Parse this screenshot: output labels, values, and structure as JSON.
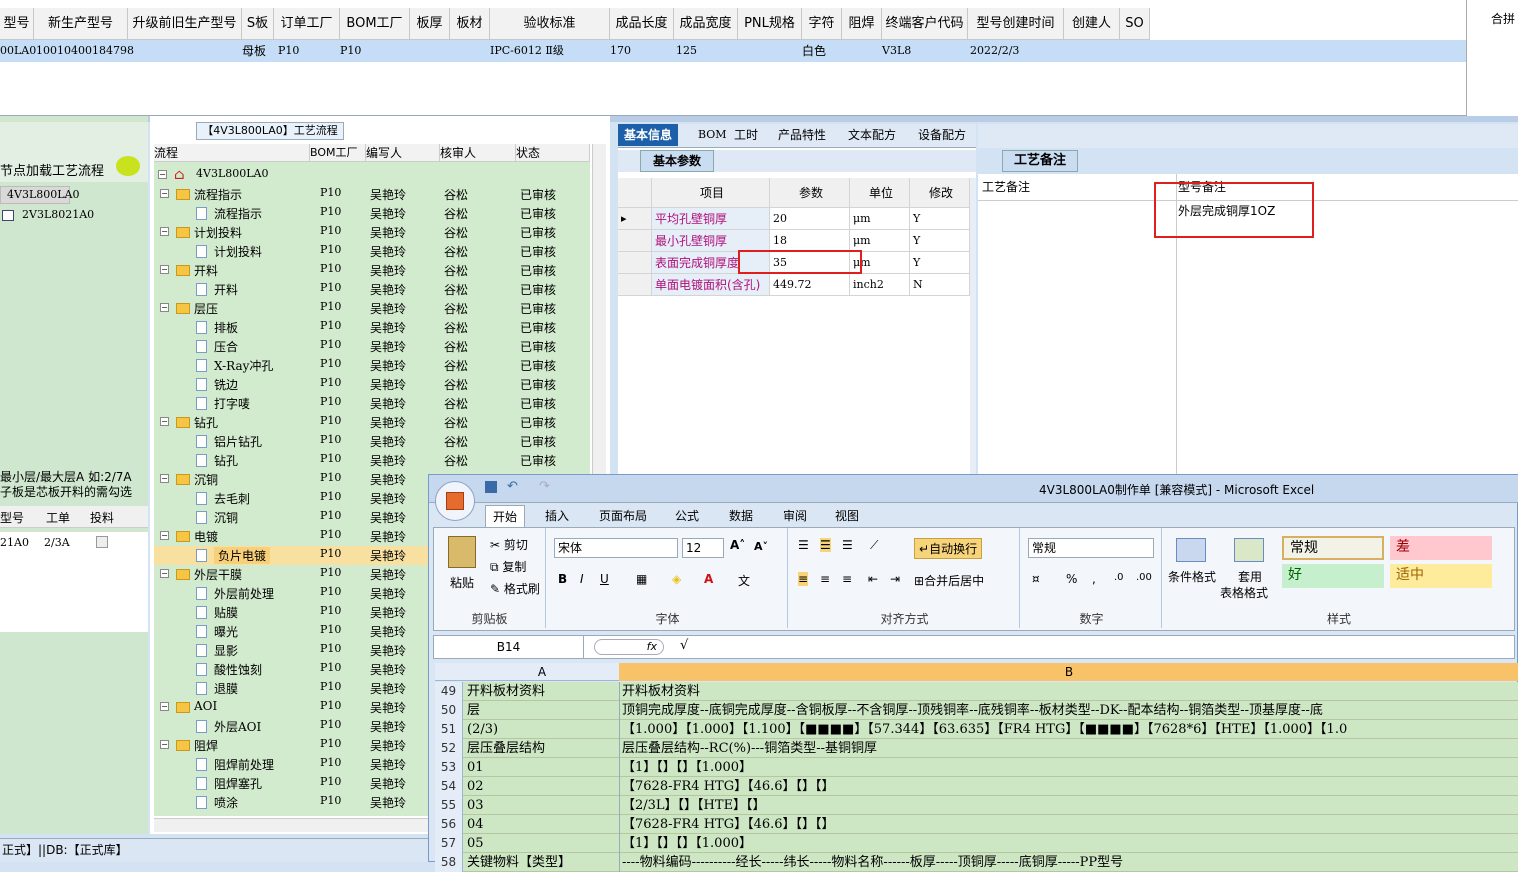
{
  "top_grid": {
    "headers": [
      "型号",
      "新生产型号",
      "升级前旧生产型号",
      "S板",
      "订单工厂",
      "BOM工厂",
      "板厚",
      "板材",
      "验收标准",
      "成品长度",
      "成品宽度",
      "PNL规格",
      "字符",
      "阻焊",
      "终端客户代码",
      "型号创建时间",
      "创建人",
      "SO"
    ],
    "row": [
      "00LA0",
      "10010400184798",
      "",
      "母板",
      "P10",
      "P10",
      "",
      "",
      "IPC-6012 Ⅱ级",
      "170",
      "125",
      "",
      "白色",
      "",
      "V3L8",
      "2022/2/3",
      "",
      ""
    ],
    "right_header": "合拼"
  },
  "left_panel": {
    "title_text": "节点加载工艺流程",
    "items": [
      "4V3L800LA0",
      "2V3L8021A0"
    ],
    "note": "最小层/最大层A 如:2/7A\n子板是芯板开料的需勾选",
    "table_headers": [
      "型号",
      "工单",
      "投料"
    ],
    "table_row": [
      "21A0",
      "2/3A",
      ""
    ],
    "chat_icon": "chat-bubble-icon"
  },
  "tree_panel": {
    "title": "【4V3L800LA0】工艺流程",
    "headers": [
      "流程",
      "BOM工厂",
      "编写人",
      "核审人",
      "状态"
    ],
    "root": "4V3L800LA0",
    "rows": [
      {
        "name": "流程指示",
        "level": 1,
        "type": "folder",
        "bom": "P10",
        "writer": "吴艳玲",
        "reviewer": "谷松",
        "status": "已审核"
      },
      {
        "name": "流程指示",
        "level": 2,
        "type": "doc",
        "bom": "P10",
        "writer": "吴艳玲",
        "reviewer": "谷松",
        "status": "已审核"
      },
      {
        "name": "计划投料",
        "level": 1,
        "type": "folder",
        "bom": "P10",
        "writer": "吴艳玲",
        "reviewer": "谷松",
        "status": "已审核"
      },
      {
        "name": "计划投料",
        "level": 2,
        "type": "doc",
        "bom": "P10",
        "writer": "吴艳玲",
        "reviewer": "谷松",
        "status": "已审核"
      },
      {
        "name": "开料",
        "level": 1,
        "type": "folder",
        "bom": "P10",
        "writer": "吴艳玲",
        "reviewer": "谷松",
        "status": "已审核"
      },
      {
        "name": "开料",
        "level": 2,
        "type": "doc",
        "bom": "P10",
        "writer": "吴艳玲",
        "reviewer": "谷松",
        "status": "已审核"
      },
      {
        "name": "层压",
        "level": 1,
        "type": "folder",
        "bom": "P10",
        "writer": "吴艳玲",
        "reviewer": "谷松",
        "status": "已审核"
      },
      {
        "name": "排板",
        "level": 2,
        "type": "doc",
        "bom": "P10",
        "writer": "吴艳玲",
        "reviewer": "谷松",
        "status": "已审核"
      },
      {
        "name": "压合",
        "level": 2,
        "type": "doc",
        "bom": "P10",
        "writer": "吴艳玲",
        "reviewer": "谷松",
        "status": "已审核"
      },
      {
        "name": "X-Ray冲孔",
        "level": 2,
        "type": "doc",
        "bom": "P10",
        "writer": "吴艳玲",
        "reviewer": "谷松",
        "status": "已审核"
      },
      {
        "name": "铣边",
        "level": 2,
        "type": "doc",
        "bom": "P10",
        "writer": "吴艳玲",
        "reviewer": "谷松",
        "status": "已审核"
      },
      {
        "name": "打字唛",
        "level": 2,
        "type": "doc",
        "bom": "P10",
        "writer": "吴艳玲",
        "reviewer": "谷松",
        "status": "已审核"
      },
      {
        "name": "钻孔",
        "level": 1,
        "type": "folder",
        "bom": "P10",
        "writer": "吴艳玲",
        "reviewer": "谷松",
        "status": "已审核"
      },
      {
        "name": "铝片钻孔",
        "level": 2,
        "type": "doc",
        "bom": "P10",
        "writer": "吴艳玲",
        "reviewer": "谷松",
        "status": "已审核"
      },
      {
        "name": "钻孔",
        "level": 2,
        "type": "doc",
        "bom": "P10",
        "writer": "吴艳玲",
        "reviewer": "谷松",
        "status": "已审核"
      },
      {
        "name": "沉铜",
        "level": 1,
        "type": "folder",
        "bom": "P10",
        "writer": "吴艳玲",
        "reviewer": "",
        "status": ""
      },
      {
        "name": "去毛刺",
        "level": 2,
        "type": "doc",
        "bom": "P10",
        "writer": "吴艳玲",
        "reviewer": "",
        "status": ""
      },
      {
        "name": "沉铜",
        "level": 2,
        "type": "doc",
        "bom": "P10",
        "writer": "吴艳玲",
        "reviewer": "",
        "status": ""
      },
      {
        "name": "电镀",
        "level": 1,
        "type": "folder",
        "bom": "P10",
        "writer": "吴艳玲",
        "reviewer": "",
        "status": ""
      },
      {
        "name": "负片电镀",
        "level": 2,
        "type": "doc",
        "bom": "P10",
        "writer": "吴艳玲",
        "reviewer": "",
        "status": "",
        "selected": true
      },
      {
        "name": "外层干膜",
        "level": 1,
        "type": "folder",
        "bom": "P10",
        "writer": "吴艳玲",
        "reviewer": "",
        "status": ""
      },
      {
        "name": "外层前处理",
        "level": 2,
        "type": "doc",
        "bom": "P10",
        "writer": "吴艳玲",
        "reviewer": "",
        "status": ""
      },
      {
        "name": "贴膜",
        "level": 2,
        "type": "doc",
        "bom": "P10",
        "writer": "吴艳玲",
        "reviewer": "",
        "status": ""
      },
      {
        "name": "曝光",
        "level": 2,
        "type": "doc",
        "bom": "P10",
        "writer": "吴艳玲",
        "reviewer": "",
        "status": ""
      },
      {
        "name": "显影",
        "level": 2,
        "type": "doc",
        "bom": "P10",
        "writer": "吴艳玲",
        "reviewer": "",
        "status": ""
      },
      {
        "name": "酸性蚀刻",
        "level": 2,
        "type": "doc",
        "bom": "P10",
        "writer": "吴艳玲",
        "reviewer": "",
        "status": ""
      },
      {
        "name": "退膜",
        "level": 2,
        "type": "doc",
        "bom": "P10",
        "writer": "吴艳玲",
        "reviewer": "",
        "status": ""
      },
      {
        "name": "AOI",
        "level": 1,
        "type": "folder",
        "bom": "P10",
        "writer": "吴艳玲",
        "reviewer": "",
        "status": ""
      },
      {
        "name": "外层AOI",
        "level": 2,
        "type": "doc",
        "bom": "P10",
        "writer": "吴艳玲",
        "reviewer": "",
        "status": ""
      },
      {
        "name": "阻焊",
        "level": 1,
        "type": "folder",
        "bom": "P10",
        "writer": "吴艳玲",
        "reviewer": "",
        "status": ""
      },
      {
        "name": "阻焊前处理",
        "level": 2,
        "type": "doc",
        "bom": "P10",
        "writer": "吴艳玲",
        "reviewer": "",
        "status": ""
      },
      {
        "name": "阻焊塞孔",
        "level": 2,
        "type": "doc",
        "bom": "P10",
        "writer": "吴艳玲",
        "reviewer": "",
        "status": ""
      },
      {
        "name": "喷涂",
        "level": 2,
        "type": "doc",
        "bom": "P10",
        "writer": "吴艳玲",
        "reviewer": "",
        "status": ""
      }
    ]
  },
  "mid_panel": {
    "tabs": [
      "基本信息",
      "BOM",
      "工时",
      "产品特性",
      "文本配方",
      "设备配方"
    ],
    "subtab": "基本参数",
    "headers": [
      "项目",
      "参数",
      "单位",
      "修改"
    ],
    "rows": [
      [
        "平均孔壁铜厚",
        "20",
        "μm",
        "Y"
      ],
      [
        "最小孔壁铜厚",
        "18",
        "μm",
        "Y"
      ],
      [
        "表面完成铜厚度",
        "35",
        "μm",
        "Y"
      ],
      [
        "单面电镀面积(含孔)",
        "449.72",
        "inch2",
        "N"
      ]
    ]
  },
  "notes_panel": {
    "tab": "工艺备注",
    "col1": "工艺备注",
    "col2": "型号备注",
    "note": "外层完成铜厚1OZ"
  },
  "excel": {
    "title": "4V3L800LA0制作单 [兼容模式] - Microsoft Excel",
    "tabs": [
      "开始",
      "插入",
      "页面布局",
      "公式",
      "数据",
      "审阅",
      "视图"
    ],
    "clipboard": {
      "paste": "粘贴",
      "cut": "剪切",
      "copy": "复制",
      "format": "格式刷",
      "label": "剪贴板"
    },
    "font": {
      "name": "宋体",
      "size": "12",
      "label": "字体"
    },
    "align": {
      "wrap": "自动换行",
      "merge": "合并后居中",
      "label": "对齐方式"
    },
    "number": {
      "format": "常规",
      "label": "数字"
    },
    "styles": {
      "cond": "条件格式",
      "table1": "套用",
      "table2": "表格格式",
      "normal": "常规",
      "bad": "差",
      "good": "好",
      "neutral": "适中",
      "label": "样式"
    },
    "namebox": "B14",
    "fx": "fx",
    "col_a": "A",
    "col_b": "B",
    "rows": [
      [
        "49",
        "开料板材资料",
        "开料板材资料"
      ],
      [
        "50",
        "层",
        "顶铜完成厚度--底铜完成厚度--含铜板厚--不含铜厚--顶残铜率--底残铜率--板材类型--DK--配本结构--铜箔类型--顶基厚度--底"
      ],
      [
        "51",
        "(2/3)",
        "【1.000】【1.000】【1.100】【■■■■】【57.344】【63.635】【FR4 HTG】【■■■■】【7628*6】【HTE】【1.000】【1.0"
      ],
      [
        "52",
        "层压叠层结构",
        "层压叠层结构--RC(%)---铜箔类型--基铜铜厚"
      ],
      [
        "53",
        "01",
        "【1】【】【】【1.000】"
      ],
      [
        "54",
        "02",
        "【7628-FR4 HTG】【46.6】【】【】"
      ],
      [
        "55",
        "03",
        "【2/3L】【】【HTE】【】"
      ],
      [
        "56",
        "04",
        "【7628-FR4 HTG】【46.6】【】【】"
      ],
      [
        "57",
        "05",
        "【1】【】【】【1.000】"
      ],
      [
        "58",
        "关键物料【类型】",
        "----物料编码----------经长-----纬长-----物料名称------板厚-----顶铜厚-----底铜厚-----PP型号"
      ]
    ]
  },
  "status_bar": "正式】||DB:【正式库】"
}
